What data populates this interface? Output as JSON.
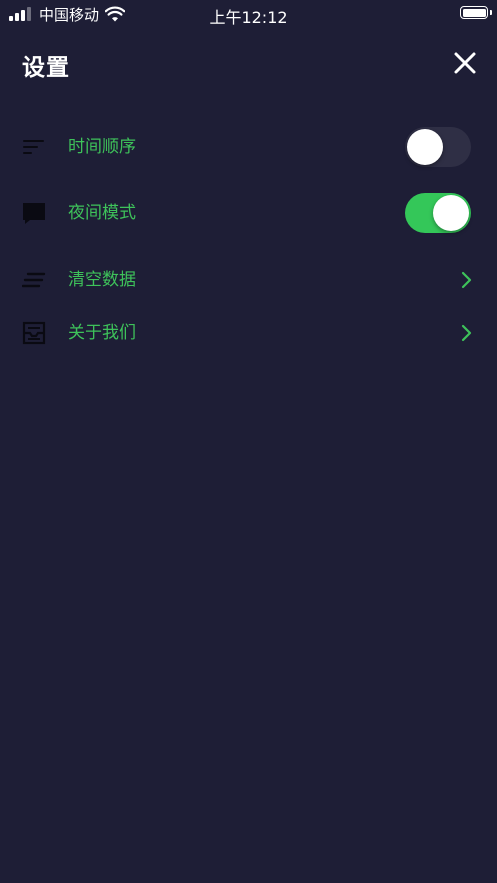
{
  "status_bar": {
    "carrier": "中国移动",
    "time": "上午12:12"
  },
  "header": {
    "title": "设置"
  },
  "settings": [
    {
      "icon": "sort-lines-icon",
      "label": "时间顺序",
      "control": "toggle",
      "on": false
    },
    {
      "icon": "chat-bubble-icon",
      "label": "夜间模式",
      "control": "toggle",
      "on": true
    },
    {
      "icon": "clear-lines-icon",
      "label": "清空数据",
      "control": "chevron"
    },
    {
      "icon": "inbox-icon",
      "label": "关于我们",
      "control": "chevron"
    }
  ],
  "colors": {
    "background": "#1e1e36",
    "accent_text": "#3ec25a",
    "toggle_on": "#34c759",
    "toggle_off": "#2f2f45"
  }
}
